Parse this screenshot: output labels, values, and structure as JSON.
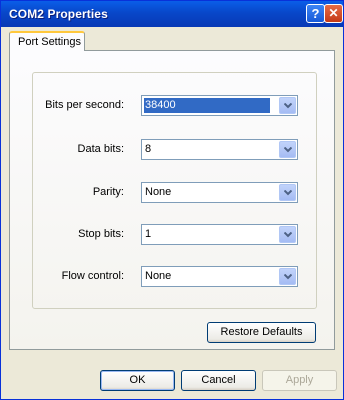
{
  "window": {
    "title": "COM2 Properties",
    "help_glyph": "?",
    "close_glyph": "✕"
  },
  "tabs": [
    {
      "label": "Port Settings"
    }
  ],
  "settings": {
    "bits_per_second": {
      "label": "Bits per second:",
      "value": "38400"
    },
    "data_bits": {
      "label": "Data bits:",
      "value": "8"
    },
    "parity": {
      "label": "Parity:",
      "value": "None"
    },
    "stop_bits": {
      "label": "Stop bits:",
      "value": "1"
    },
    "flow_control": {
      "label": "Flow control:",
      "value": "None"
    }
  },
  "buttons": {
    "restore_defaults": "Restore Defaults",
    "ok": "OK",
    "cancel": "Cancel",
    "apply": "Apply"
  }
}
